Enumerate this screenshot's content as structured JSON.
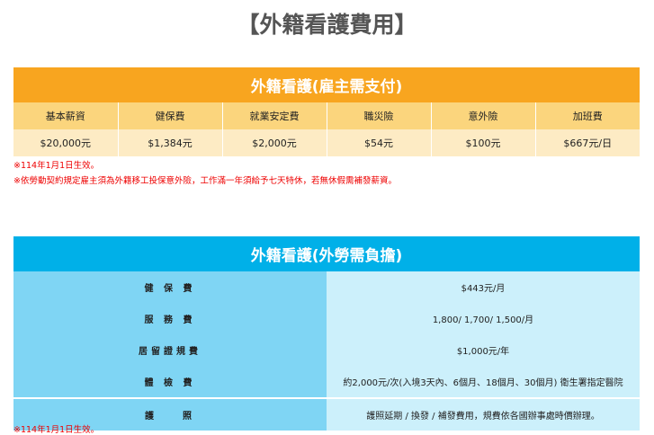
{
  "title": "【外籍看護費用】",
  "employer": {
    "heading": "外籍看護(雇主需支付)",
    "columns": [
      {
        "label": "基本薪資",
        "value": "$20,000元"
      },
      {
        "label": "健保費",
        "value": "$1,384元"
      },
      {
        "label": "就業安定費",
        "value": "$2,000元"
      },
      {
        "label": "職災險",
        "value": "$54元"
      },
      {
        "label": "意外險",
        "value": "$100元"
      },
      {
        "label": "加班費",
        "value": "$667元/日"
      }
    ],
    "notes": [
      "※114年1月1日生效。",
      "※依勞動契約規定雇主須為外籍移工投保意外險，工作滿一年須給予七天特休，若無休假需補發薪資。"
    ]
  },
  "worker": {
    "heading": "外籍看護(外勞需負擔)",
    "rows": [
      {
        "label": "健 保 費",
        "value": "$443元/月"
      },
      {
        "label": "服 務 費",
        "value": "1,800/ 1,700/ 1,500/月"
      },
      {
        "label": "居留證規費",
        "value": "$1,000元/年"
      },
      {
        "label": "體 檢 費",
        "value": "約2,000元/次(入境3天內、6個月、18個月、30個月) 衛生署指定醫院"
      },
      {
        "label": "護　　照",
        "value": "護照延期 / 換發 / 補發費用，規費依各國辦事處時價辦理。"
      }
    ],
    "note": "※114年1月1日生效。"
  }
}
